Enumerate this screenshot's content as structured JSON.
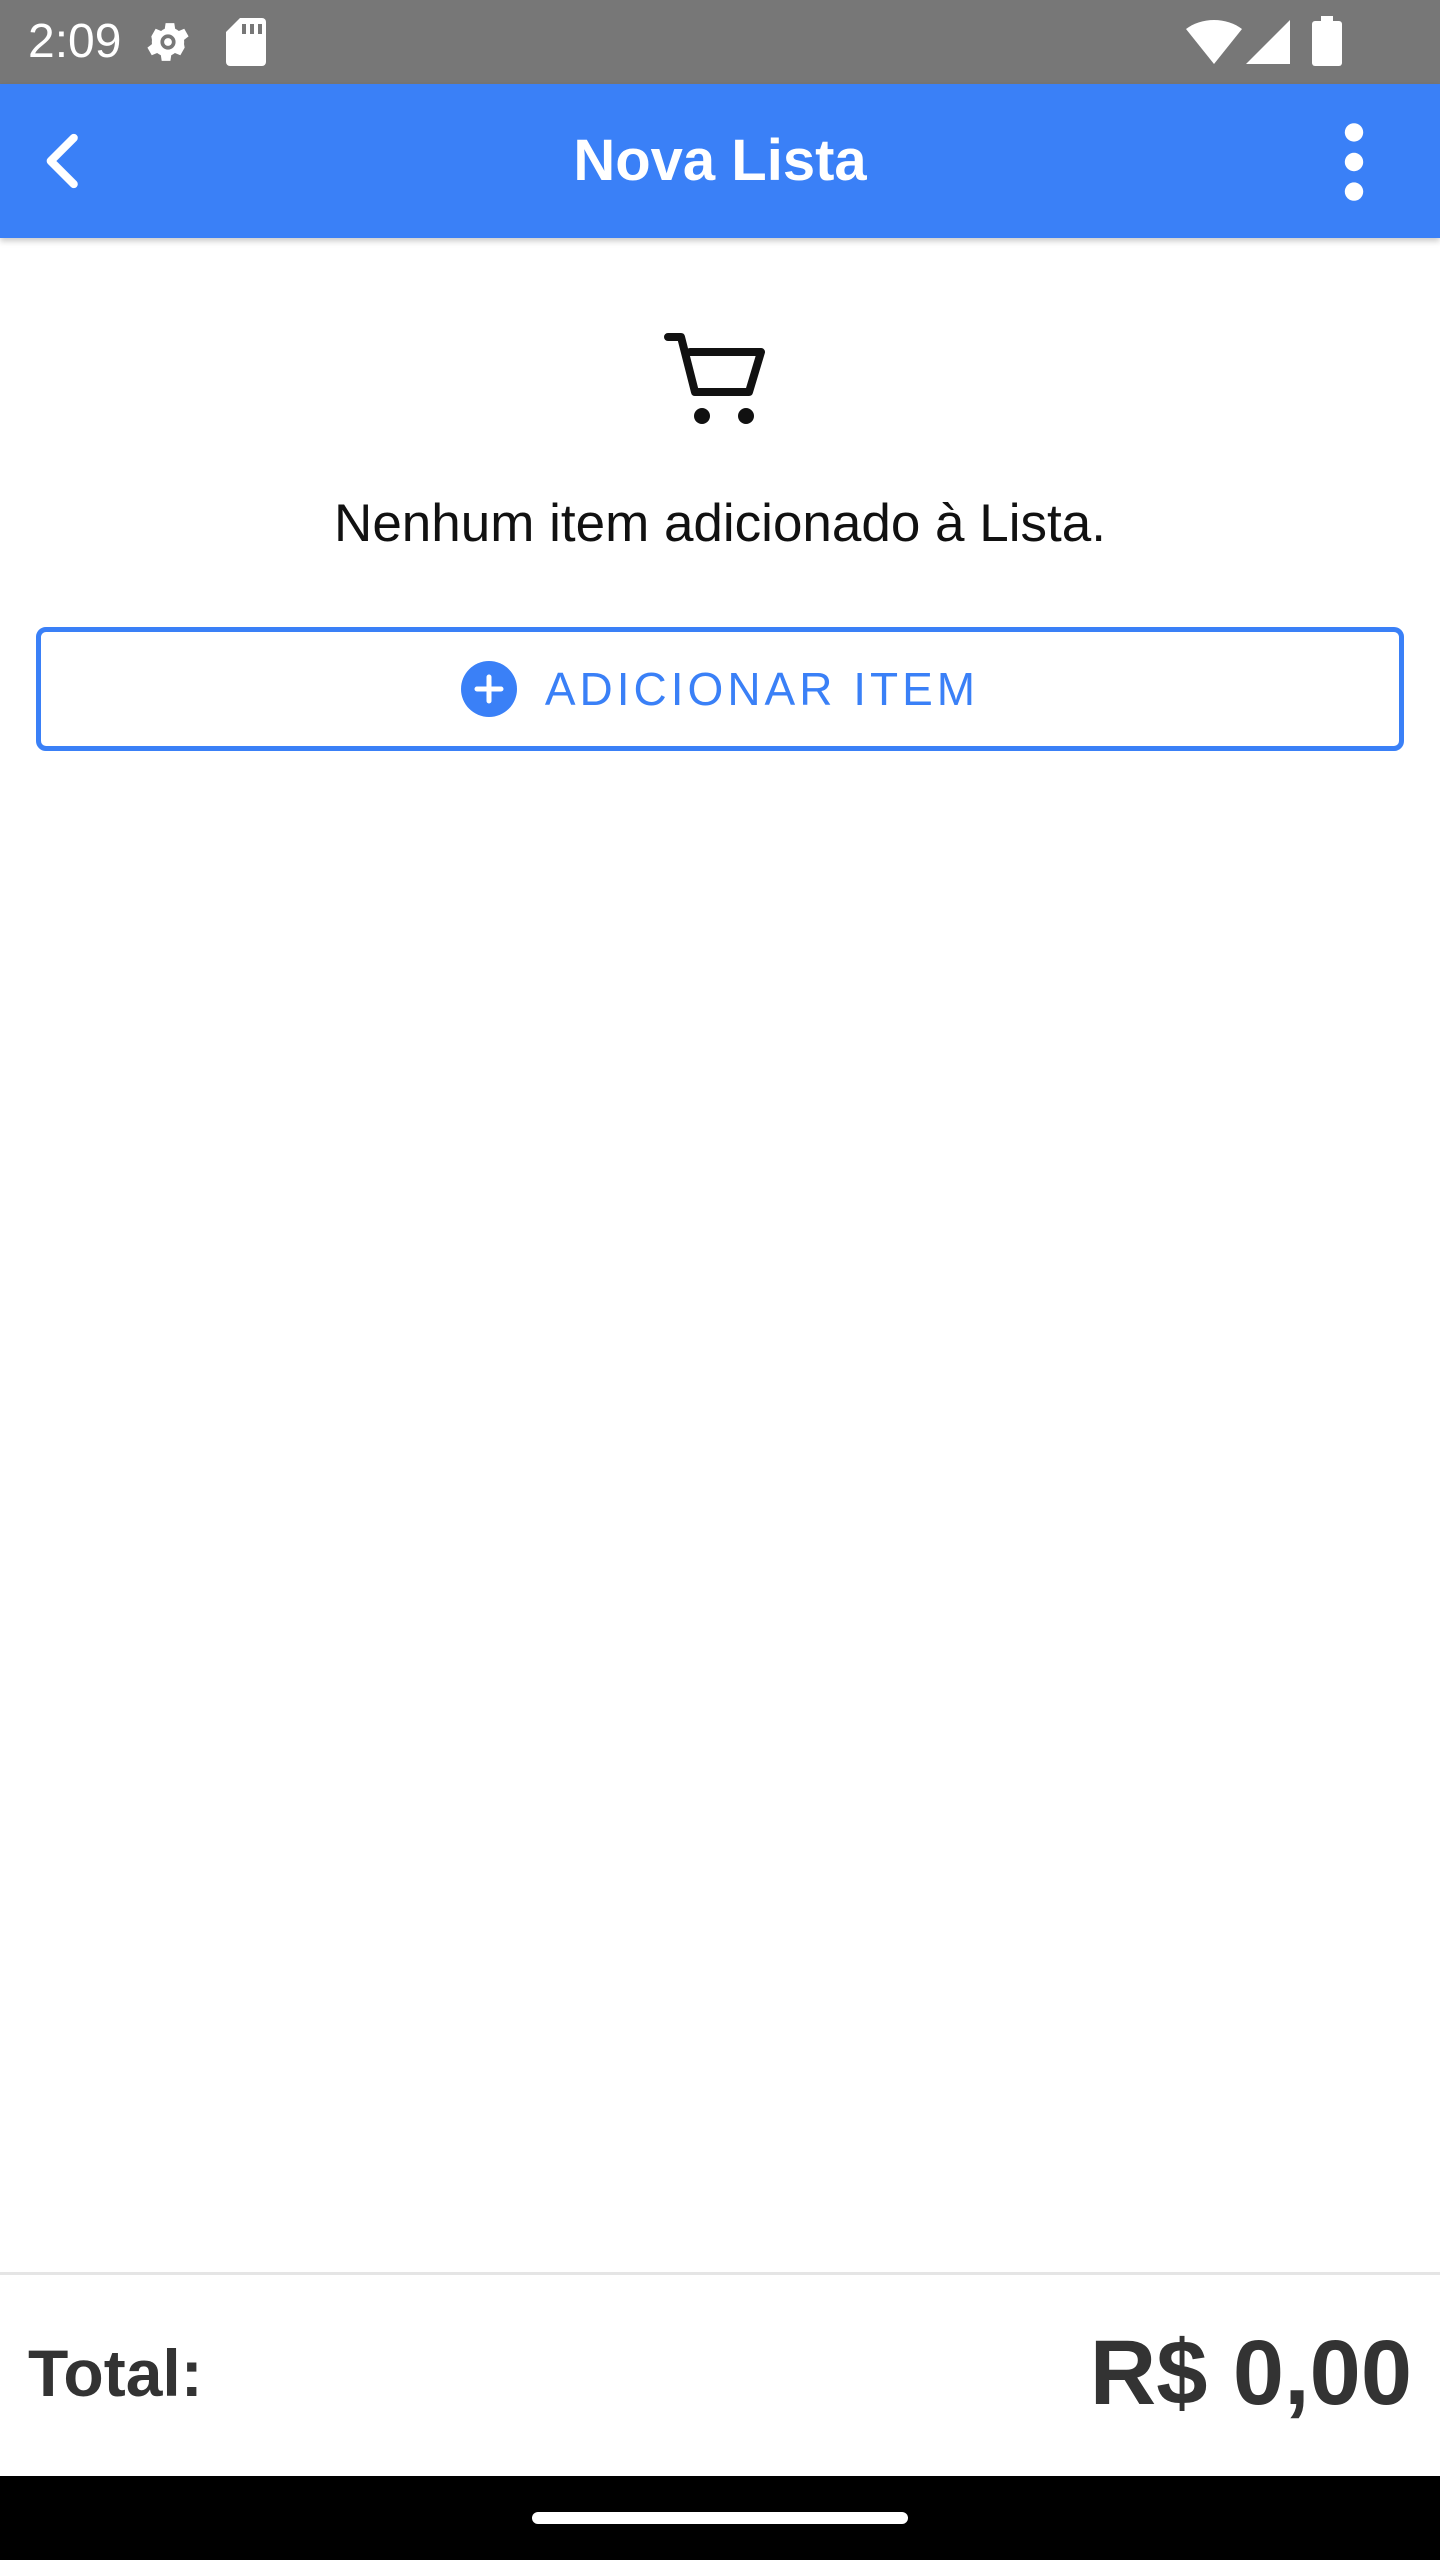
{
  "status_bar": {
    "time": "2:09",
    "icons": [
      "settings-gear-icon",
      "sd-card-icon",
      "wifi-icon",
      "cell-signal-icon",
      "battery-icon"
    ]
  },
  "app_bar": {
    "title": "Nova Lista",
    "back_icon": "chevron-left-icon",
    "menu_icon": "more-vert-icon",
    "background_color": "#3a80f7"
  },
  "empty_state": {
    "icon": "shopping-cart-icon",
    "message": "Nenhum item adicionado à Lista."
  },
  "add_item_button": {
    "label": "ADICIONAR ITEM",
    "icon": "add-circle-icon",
    "color": "#3a80f7"
  },
  "footer": {
    "total_label": "Total:",
    "total_value": "R$ 0,00"
  },
  "nav_bar": {
    "indicator": "home-indicator"
  }
}
